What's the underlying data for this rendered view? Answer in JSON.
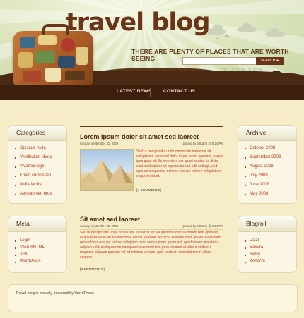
{
  "header": {
    "site_title": "travel blog",
    "tagline": "THERE ARE PLENTY OF PLACES THAT ARE WORTH SEEING",
    "search_placeholder": "",
    "search_button": "SEARCH ►",
    "tour_text": "TOUR"
  },
  "nav": {
    "items": [
      "LATEST NEWS",
      "CONTACT US"
    ]
  },
  "categories": {
    "title": "Categories",
    "items": [
      "Quisque nulla",
      "Vestibulum libero",
      "Vivamus eget",
      "Etiam cursus leo",
      "Nulla facilisi",
      "Aenean nec eros"
    ]
  },
  "meta": {
    "title": "Meta",
    "items": [
      "Login",
      "Valid XHTML",
      "XFN",
      "WordPress"
    ]
  },
  "archive": {
    "title": "Archive",
    "items": [
      "October 2008",
      "September 2008",
      "August 2008",
      "July 2008",
      "June 2008",
      "May 2008"
    ]
  },
  "blogroll": {
    "title": "Blogroll",
    "items": [
      "Dizzr",
      "Sakura",
      "Betsy",
      "Kodachi"
    ]
  },
  "posts": [
    {
      "title": "Lorem ipsum dolor sit amet sed laoreet",
      "date": "sunday, september 22, 2008",
      "author": "posted by allCarry @ 5:24 PM",
      "body": "Sed ut perspiciatis unde omnis iste natuerror sit voluptatem accusant dolor mque totam aperiam, eaque ipsa quae ab illo inventore ver quasi beatae tia dicta sunt explicabitur sit aspernatur aut odit autfugit, sed quia consequuntur dolores eos qui ratione voluptatem sequi nesciunt.",
      "comments": "[4 COMMENTS]"
    },
    {
      "title": "Sit amet sed laoreet",
      "date": "sunday, september 22, 2008",
      "author": "posted by allCarry @ 5:24 PM",
      "body": "Sed ut perspiciatis unde omnis iste natuerror sit voluptatem dolor auctotam rem aperiam, eaque ipsa quae ab illo inventore veritat quasiber ad dicta suneme enim ipsam voluptatem quiadolores eos qui ratione voluptem nesq neque porro quam est, qui dolorem ipsectetur, adipisci velit, sed quia non numquam eius modi tem pora incidunt ut labore et dolore magnam aliquam quaerat vol ad minima veniam, quis nostrum exercitationem ullam corpore.",
      "comments": "[4 COMMENTS]"
    }
  ],
  "footer": {
    "text": "Travel blog is proudly powered by WordPress"
  }
}
